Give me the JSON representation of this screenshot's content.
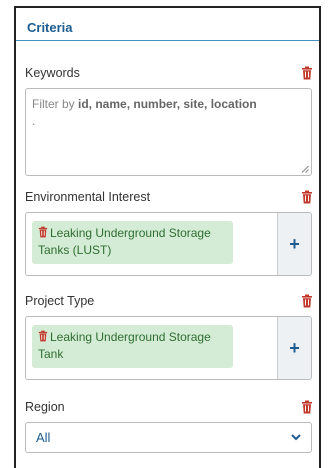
{
  "panel": {
    "title": "Criteria"
  },
  "keywords": {
    "label": "Keywords",
    "placeholder_prefix": "Filter by ",
    "placeholder_bold": "id, name, number, site, location",
    "placeholder_suffix": ".",
    "value": ""
  },
  "environmental_interest": {
    "label": "Environmental Interest",
    "tags": [
      "Leaking Underground Storage Tanks (LUST)"
    ],
    "add_label": "+"
  },
  "project_type": {
    "label": "Project Type",
    "tags": [
      "Leaking Underground Storage Tank"
    ],
    "add_label": "+"
  },
  "region": {
    "label": "Region",
    "selected": "All"
  },
  "icons": {
    "trash": "trash-icon",
    "add": "plus-icon",
    "chevron": "chevron-down-icon"
  },
  "colors": {
    "accent": "#1d5c8f",
    "trash": "#c0392b",
    "tag_bg": "#d4ecd6",
    "tag_text": "#2e6e30"
  }
}
